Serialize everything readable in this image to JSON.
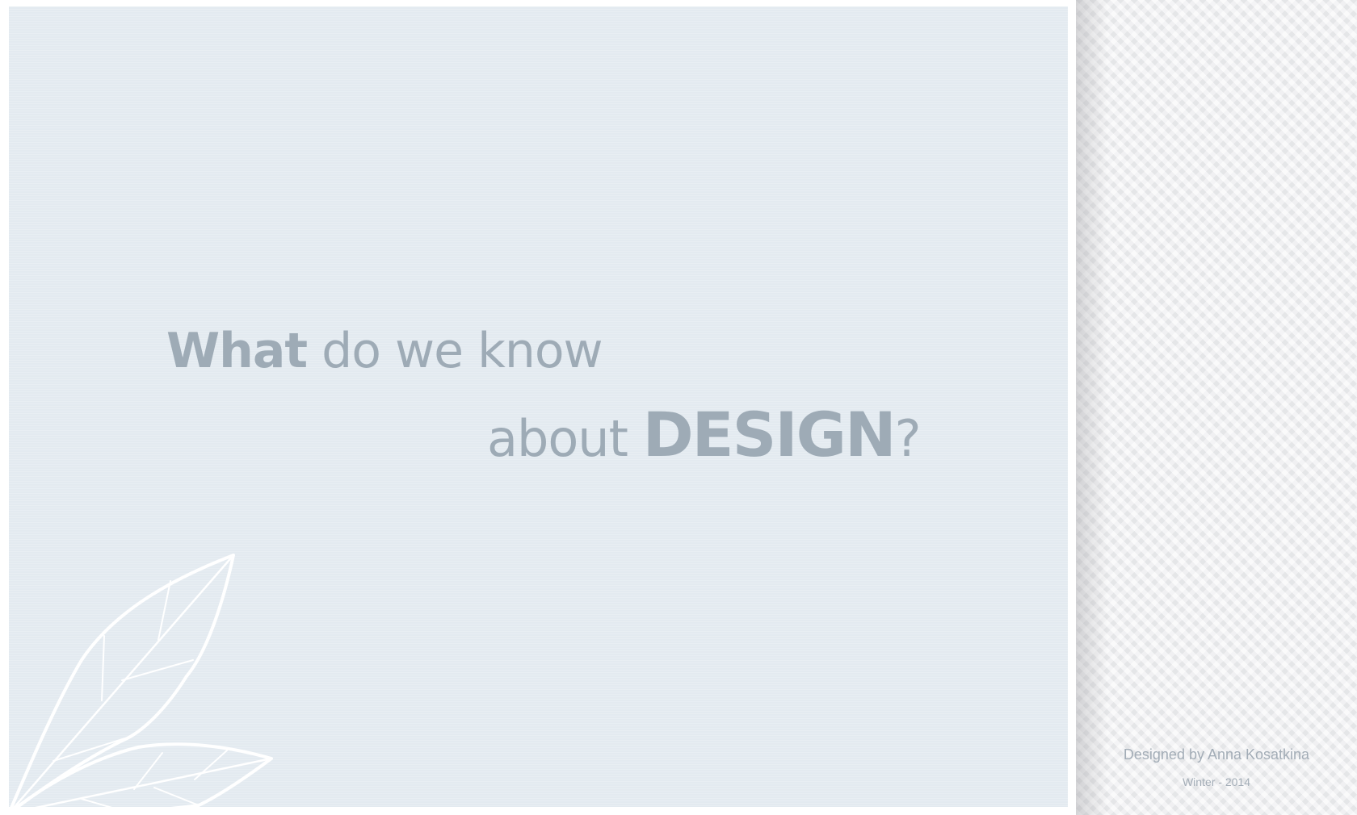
{
  "headline": {
    "line1_strong": "What",
    "line1_rest": " do we know",
    "line2_pre": "about ",
    "line2_strong": "DESIGN",
    "line2_post": "?"
  },
  "credit": {
    "author": "Designed by Anna Kosatkina",
    "date": "Winter - 2014"
  },
  "colors": {
    "panel_bg": "#e3eaf0",
    "text": "#9eabb6",
    "side_bg": "#eeeff1",
    "leaf": "#ffffff"
  },
  "icons": {
    "decoration": "leaf-outline-icon"
  }
}
